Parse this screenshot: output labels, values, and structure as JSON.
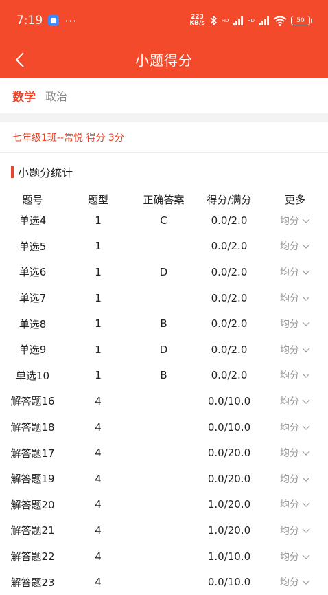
{
  "status": {
    "time": "7:19",
    "more": "···",
    "netspeed_top": "223",
    "netspeed_bottom": "KB/s",
    "hd1": "HD",
    "hd2": "HD",
    "battery": "50"
  },
  "header": {
    "title": "小题得分"
  },
  "subjects": [
    {
      "label": "数学",
      "active": true
    },
    {
      "label": "政治",
      "active": false
    }
  ],
  "student_info": "七年级1班--常悦 得分 3分",
  "section": {
    "title": "小题分统计"
  },
  "table": {
    "headers": [
      "题号",
      "题型",
      "正确答案",
      "得分/满分",
      "更多"
    ],
    "rows": [
      [
        "单选4",
        "1",
        "C",
        "0.0/2.0",
        "均分"
      ],
      [
        "单选5",
        "1",
        "",
        "0.0/2.0",
        "均分"
      ],
      [
        "单选6",
        "1",
        "D",
        "0.0/2.0",
        "均分"
      ],
      [
        "单选7",
        "1",
        "",
        "0.0/2.0",
        "均分"
      ],
      [
        "单选8",
        "1",
        "B",
        "0.0/2.0",
        "均分"
      ],
      [
        "单选9",
        "1",
        "D",
        "0.0/2.0",
        "均分"
      ],
      [
        "单选10",
        "1",
        "B",
        "0.0/2.0",
        "均分"
      ],
      [
        "解答题16",
        "4",
        "",
        "0.0/10.0",
        "均分"
      ],
      [
        "解答题18",
        "4",
        "",
        "0.0/10.0",
        "均分"
      ],
      [
        "解答题17",
        "4",
        "",
        "0.0/20.0",
        "均分"
      ],
      [
        "解答题19",
        "4",
        "",
        "0.0/20.0",
        "均分"
      ],
      [
        "解答题20",
        "4",
        "",
        "1.0/20.0",
        "均分"
      ],
      [
        "解答题21",
        "4",
        "",
        "1.0/20.0",
        "均分"
      ],
      [
        "解答题22",
        "4",
        "",
        "1.0/10.0",
        "均分"
      ],
      [
        "解答题23",
        "4",
        "",
        "0.0/10.0",
        "均分"
      ]
    ]
  },
  "colors": {
    "accent": "#f24a2a",
    "accent_text": "#e8452a",
    "muted": "#999999"
  }
}
